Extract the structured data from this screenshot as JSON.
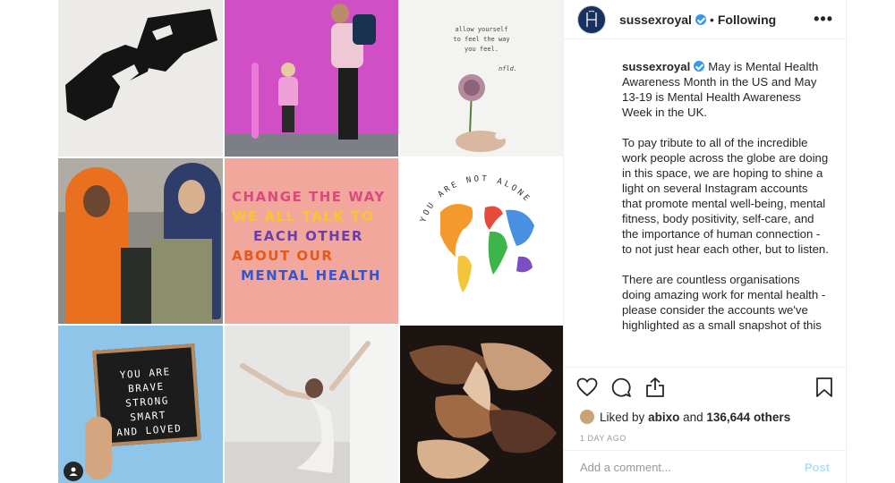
{
  "header": {
    "username": "sussexroyal",
    "separator": "•",
    "follow_label": "Following",
    "more_label": "•••"
  },
  "grid": {
    "note_text": [
      "allow yourself",
      "to feel the way",
      "you feel."
    ],
    "note_signature": "nfld.",
    "slogan_lines": [
      "CHANGE THE WAY",
      "WE ALL TALK TO",
      "EACH OTHER",
      "ABOUT OUR",
      "MENTAL HEALTH"
    ],
    "globe_text": "YOU ARE NOT ALONE",
    "board_lines": [
      "YOU ARE",
      "BRAVE",
      "STRONG",
      "SMART",
      "AND LOVED"
    ]
  },
  "caption": {
    "username": "sussexroyal",
    "paragraphs": [
      "May is Mental Health Awareness Month in the US and May 13-19 is Mental Health Awareness Week in the UK.",
      "To pay tribute to all of the incredible work people across the globe are doing in this space, we are hoping to shine a light on several Instagram accounts that promote mental well-being, mental fitness, body positivity, self-care, and the importance of human connection - to not just hear each other, but to listen.",
      "There are countless organisations doing amazing work for mental health - please consider the accounts we've highlighted as a small snapshot of this"
    ]
  },
  "likes": {
    "prefix": "Liked by",
    "user": "abixo",
    "middle": "and",
    "count": "136,644 others"
  },
  "timestamp": "1 DAY AGO",
  "comment": {
    "placeholder": "Add a comment...",
    "post_label": "Post"
  },
  "colors": {
    "verified": "#3897f0",
    "post_disabled": "#b2dffc",
    "muted": "#999999"
  }
}
